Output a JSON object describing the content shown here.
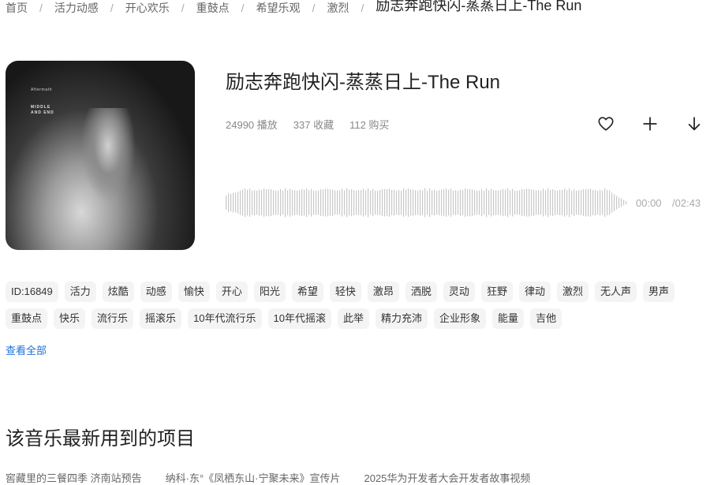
{
  "breadcrumb": {
    "items": [
      "首页",
      "活力动感",
      "开心欢乐",
      "重鼓点",
      "希望乐观",
      "激烈"
    ],
    "separator": "/",
    "current": "励志奔跑快闪-蒸蒸日上-The Run"
  },
  "cover": {
    "line1": "Aftermath",
    "line2": "MIDDLE",
    "line3": "AND END"
  },
  "song": {
    "title": "励志奔跑快闪-蒸蒸日上-The Run",
    "plays": "24990 播放",
    "favorites": "337 收藏",
    "purchases": "112 购买"
  },
  "actions": {
    "favorite_icon": "heart-icon",
    "add_icon": "plus-icon",
    "download_icon": "download-icon"
  },
  "player": {
    "current_time": "00:00",
    "total_time": "/02:43",
    "progress": 0
  },
  "tags": [
    "ID:16849",
    "活力",
    "炫酷",
    "动感",
    "愉快",
    "开心",
    "阳光",
    "希望",
    "轻快",
    "激昂",
    "洒脱",
    "灵动",
    "狂野",
    "律动",
    "激烈",
    "无人声",
    "男声",
    "重鼓点",
    "快乐",
    "流行乐",
    "摇滚乐",
    "10年代流行乐",
    "10年代摇滚",
    "此举",
    "精力充沛",
    "企业形象",
    "能量",
    "吉他"
  ],
  "view_all": "查看全部",
  "section": {
    "title": "该音乐最新用到的项目",
    "projects": [
      "窖藏里的三餐四季 济南站预告",
      "纳科·东°《凤栖东山·宁聚未来》宣传片",
      "2025华为开发者大会开发者故事视频"
    ]
  },
  "colors": {
    "accent_link": "#1e6fd9",
    "tag_bg": "#f4f4f4",
    "waveform": "#c8c8c8"
  }
}
